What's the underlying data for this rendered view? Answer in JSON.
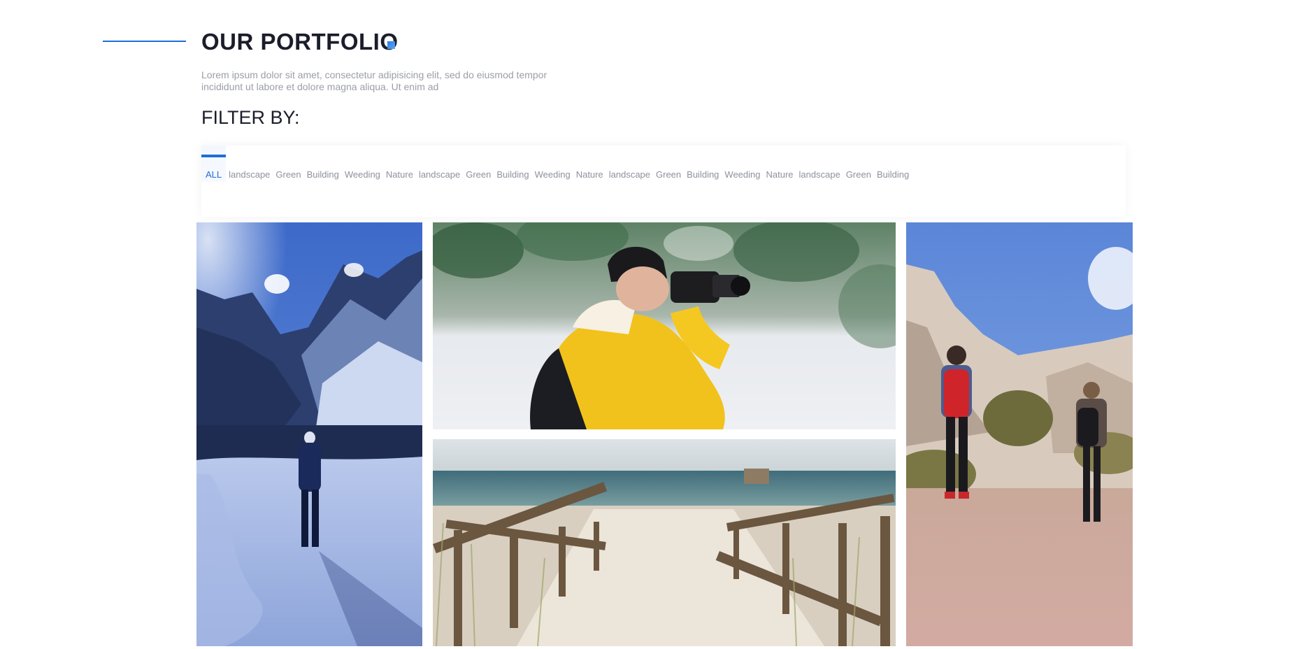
{
  "header": {
    "title": "OUR PORTFOLIO",
    "subtitle": "Lorem ipsum dolor sit amet, consectetur adipisicing elit, sed do eiusmod tempor incididunt ut labore et dolore magna aliqua. Ut enim ad",
    "accent_color": "#1f6fd6"
  },
  "filter": {
    "heading": "FILTER BY:",
    "items": [
      {
        "label": "ALL",
        "active": true
      },
      {
        "label": "landscape"
      },
      {
        "label": "Green"
      },
      {
        "label": "Building"
      },
      {
        "label": "Weeding"
      },
      {
        "label": "Nature"
      },
      {
        "label": "landscape"
      },
      {
        "label": "Green"
      },
      {
        "label": "Building"
      },
      {
        "label": "Weeding"
      },
      {
        "label": "Nature"
      },
      {
        "label": "landscape"
      },
      {
        "label": "Green"
      },
      {
        "label": "Building"
      },
      {
        "label": "Weeding"
      },
      {
        "label": "Nature"
      },
      {
        "label": "landscape"
      },
      {
        "label": "Green"
      },
      {
        "label": "Building"
      }
    ]
  },
  "gallery": {
    "photos": [
      {
        "name": "snowy-mountain-lake-hiker-photo"
      },
      {
        "name": "photographer-yellow-jacket-photo"
      },
      {
        "name": "beach-boardwalk-photo"
      },
      {
        "name": "desert-hikers-photo"
      }
    ]
  }
}
